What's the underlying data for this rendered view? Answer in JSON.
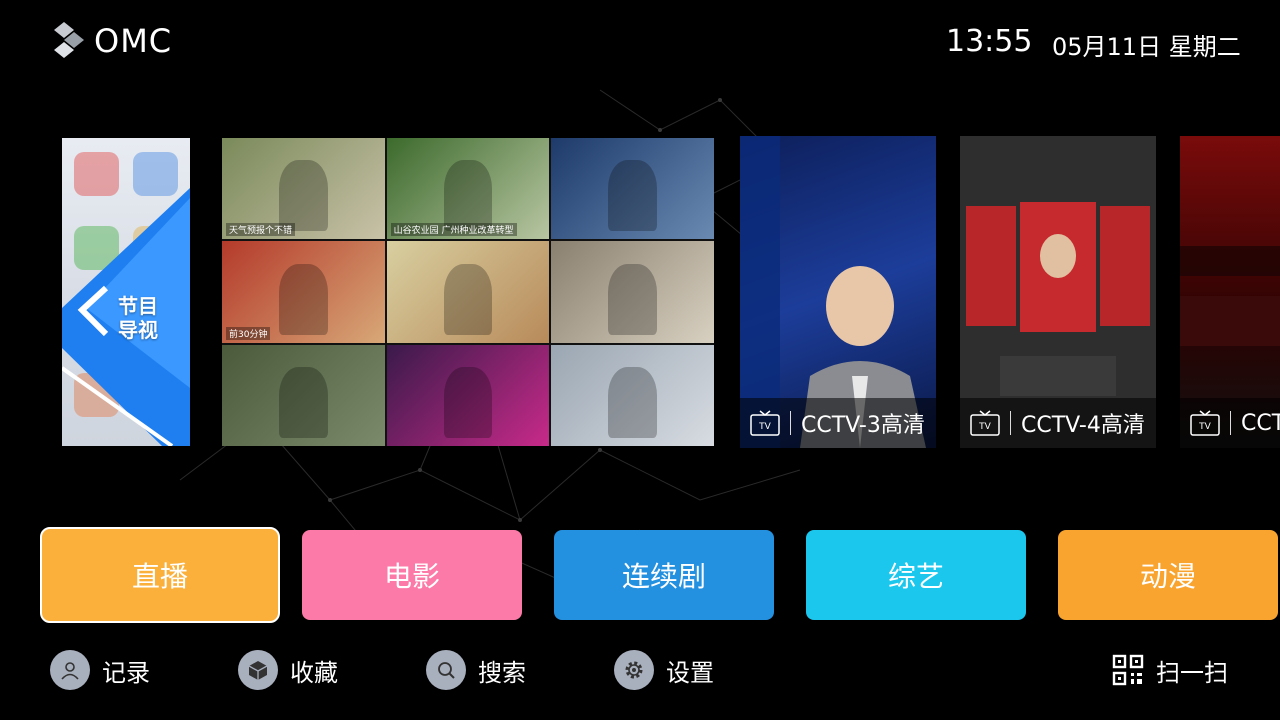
{
  "header": {
    "logo_text": "OMC",
    "time": "13:55",
    "date": "05月11日 星期二"
  },
  "guide_card": {
    "label": "节目导视"
  },
  "mosaic": {
    "tiles": [
      {
        "caption": "天气预报个不错",
        "colors": [
          "#7a8a5a",
          "#c9c2a8"
        ]
      },
      {
        "caption": "山谷农业园 广州种业改革转型",
        "colors": [
          "#3c6a2c",
          "#b8c6a2"
        ]
      },
      {
        "caption": "",
        "colors": [
          "#1d3a6a",
          "#6a8ab2"
        ]
      },
      {
        "caption": "前30分钟",
        "colors": [
          "#b43a2a",
          "#d8a878"
        ]
      },
      {
        "caption": "",
        "colors": [
          "#d8cfa0",
          "#b88a5a"
        ]
      },
      {
        "caption": "",
        "colors": [
          "#8a8070",
          "#d8d0c0"
        ]
      },
      {
        "caption": "",
        "colors": [
          "#4a5a3a",
          "#7a8a6a"
        ]
      },
      {
        "caption": "",
        "colors": [
          "#3a1a4a",
          "#c82a8a"
        ]
      },
      {
        "caption": "",
        "colors": [
          "#9aa6b2",
          "#d8dce2"
        ]
      }
    ]
  },
  "posters": [
    {
      "channel": "CCTV-3高清",
      "icon": "tv-icon"
    },
    {
      "channel": "CCTV-4高清",
      "icon": "tv-icon"
    },
    {
      "channel": "CCT",
      "icon": "tv-icon"
    }
  ],
  "categories": {
    "live": "直播",
    "movie": "电影",
    "series": "连续剧",
    "variety": "综艺",
    "anime": "动漫"
  },
  "nav": {
    "history": "记录",
    "favorites": "收藏",
    "search": "搜索",
    "settings": "设置",
    "scan": "扫一扫"
  }
}
